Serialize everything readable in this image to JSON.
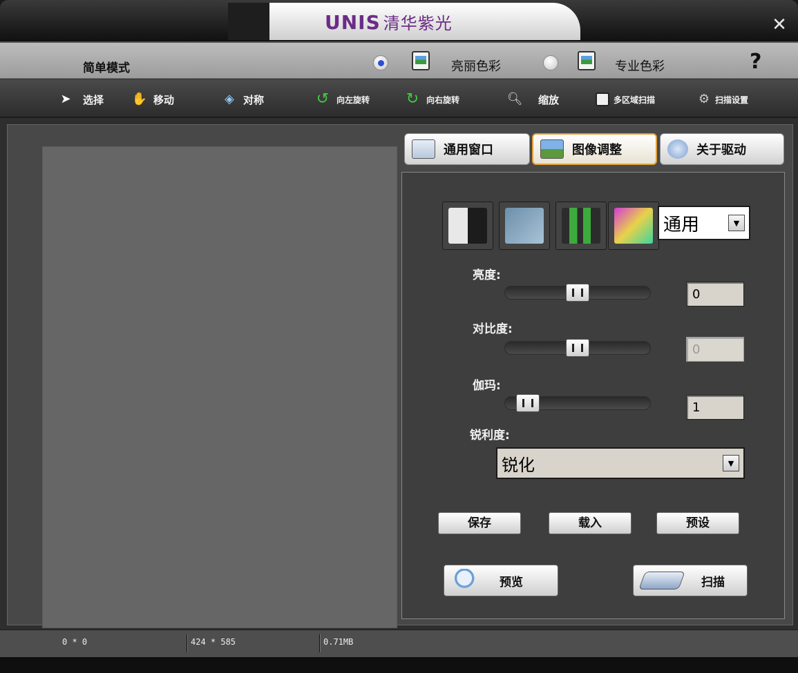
{
  "app": {
    "logo": "UNIS",
    "logo_cn": "清华紫光",
    "close": "✕"
  },
  "modebar": {
    "title": "简单模式",
    "mode_vivid": "亮丽色彩",
    "mode_pro": "专业色彩",
    "help": "?"
  },
  "toolbar": {
    "select": "选择",
    "move": "移动",
    "mirror": "对称",
    "rotate_left": "向左旋转",
    "rotate_right": "向右旋转",
    "zoom": "缩放",
    "multi_scan": "多区域扫描",
    "scan_settings": "扫描设置"
  },
  "tabs": {
    "general": "通用窗口",
    "image": "图像调整",
    "about": "关于驱动"
  },
  "panel": {
    "preset_value": "通用",
    "brightness_label": "亮度:",
    "brightness_value": "0",
    "contrast_label": "对比度:",
    "contrast_value": "0",
    "gamma_label": "伽玛:",
    "gamma_value": "1",
    "sharpness_label": "锐利度:",
    "sharpness_value": "锐化",
    "save": "保存",
    "load": "载入",
    "preset": "预设",
    "preview": "预览",
    "scan": "扫描"
  },
  "status": {
    "selection": "0 * 0",
    "size": "424 * 585",
    "filesize": "0.71MB"
  },
  "colors": {
    "logo": "#6b2c86",
    "active_tab_border": "#e2a13a",
    "radio_dot": "#2c4fd6"
  }
}
